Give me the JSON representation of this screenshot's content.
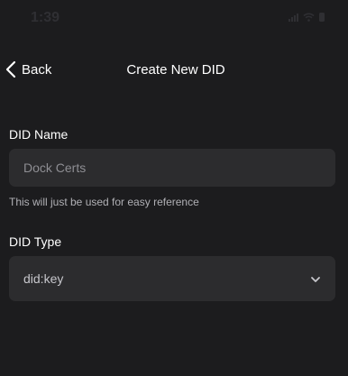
{
  "status_bar": {
    "time": "1:39"
  },
  "nav": {
    "back_label": "Back",
    "title": "Create New DID"
  },
  "form": {
    "name_label": "DID Name",
    "name_value": "Dock Certs",
    "name_helper": "This will just be used for easy reference",
    "type_label": "DID Type",
    "type_value": "did:key"
  },
  "icons": {
    "back": "chevron-left-icon",
    "dropdown": "chevron-down-icon",
    "signal": "signal-icon",
    "wifi": "wifi-icon",
    "battery": "battery-icon"
  },
  "colors": {
    "background": "#1c1c1e",
    "field": "#2c2c2e",
    "text": "#ffffff",
    "muted": "#8e8e93"
  }
}
